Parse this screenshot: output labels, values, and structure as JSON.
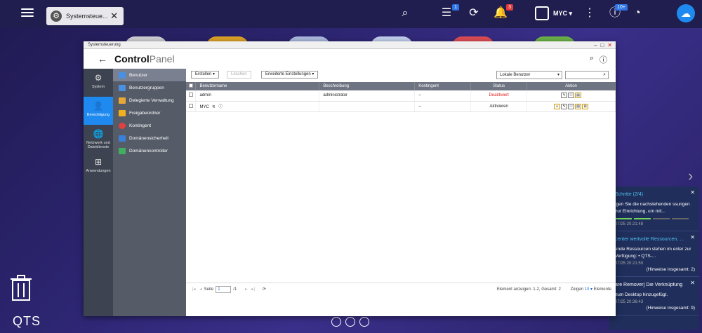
{
  "taskbar": {
    "tab_label": "Systemsteue...",
    "user_name": "MYC ▾",
    "badge_tasks": "1",
    "badge_notifications": "3",
    "badge_updates": "10+"
  },
  "desktop": {
    "os_label": "QTS"
  },
  "window": {
    "title": "Systemsteuerung",
    "header_title_bold": "Control",
    "header_title_light": "Panel"
  },
  "nav_main": [
    {
      "label": "System",
      "icon": "gear-icon"
    },
    {
      "label": "Berechtigung",
      "icon": "user-icon"
    },
    {
      "label": "Netzwerk und Dateidienste",
      "icon": "globe-icon"
    },
    {
      "label": "Anwendungen",
      "icon": "apps-icon"
    }
  ],
  "nav_sub": [
    {
      "label": "Benutzer",
      "color": "#4a90e2"
    },
    {
      "label": "Benutzergruppen",
      "color": "#4a90e2"
    },
    {
      "label": "Delegierte Verwaltung",
      "color": "#e8a838"
    },
    {
      "label": "Freigabeordner",
      "color": "#f0b020"
    },
    {
      "label": "Kontingent",
      "color": "#e04040"
    },
    {
      "label": "Domänensicherheit",
      "color": "#3a7fd8"
    },
    {
      "label": "Domänencontroller",
      "color": "#40b060"
    }
  ],
  "toolbar": {
    "create": "Erstellen ▾",
    "delete": "Löschen",
    "advanced": "Erweiterte Einstellungen ▾",
    "scope": "Lokale Benutzer"
  },
  "table": {
    "headers": [
      "Benutzername",
      "Beschreibung",
      "Kontingent",
      "Status",
      "Aktion"
    ],
    "rows": [
      {
        "name": "admin",
        "description": "administrator",
        "quota": "--",
        "status": "Deaktiviert"
      },
      {
        "name": "MYC",
        "description": "",
        "quota": "--",
        "status": "Aktivieren"
      }
    ]
  },
  "pager": {
    "page_label": "Seite",
    "page": "1",
    "total": "/1",
    "summary": "Element anzeigen: 1-2, Gesamt: 2",
    "show_label": "Zeigen",
    "show_count": "10",
    "items_label": "Elemente"
  },
  "notifications": [
    {
      "title": "Schritte (2/4)",
      "body": "igen Sie die nachstehenden ssungen zur Einrichtung, um mit...",
      "time": "07/25 20:21:48",
      "summary": ""
    },
    {
      "title": "center wertvolle Ressourcen, ...",
      "body": "ende Ressourcen stehen im enter zur Verfügung: • QTS-...",
      "time": "07/25 20:21:50",
      "summary": "(Hinweise insgesamt: 2)"
    },
    {
      "title": "are Remover] Die Verknüpfung",
      "body": "zum Desktop hinzugefügt.",
      "time": "07/25 20:36:43",
      "summary": "(Hinweise insgesamt: 9)"
    }
  ]
}
